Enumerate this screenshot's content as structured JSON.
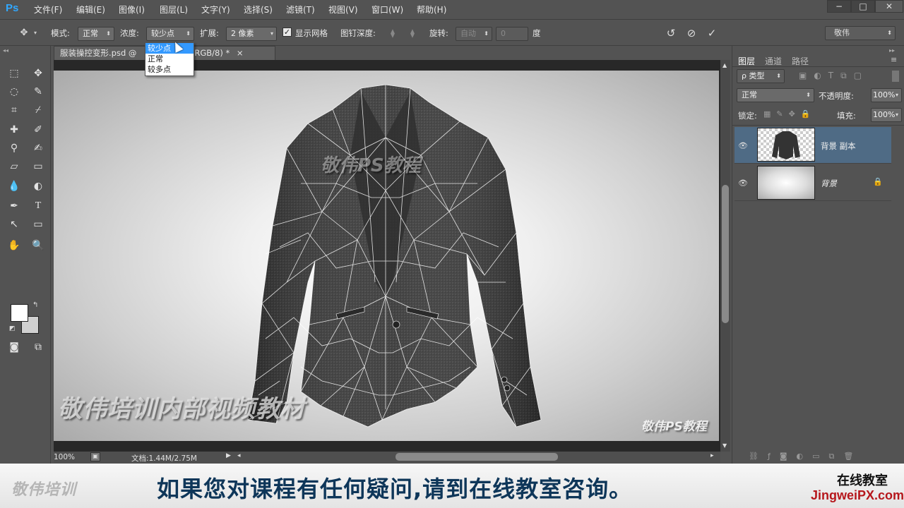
{
  "app": {
    "logo": "Ps"
  },
  "menu": [
    "文件(F)",
    "编辑(E)",
    "图像(I)",
    "图层(L)",
    "文字(Y)",
    "选择(S)",
    "滤镜(T)",
    "视图(V)",
    "窗口(W)",
    "帮助(H)"
  ],
  "window_controls": {
    "minimize": "−",
    "maximize": "□",
    "close": "✕"
  },
  "options": {
    "mode_label": "模式:",
    "mode_value": "正常",
    "density_label": "浓度:",
    "density_value": "较少点",
    "expand_label": "扩展:",
    "expand_value": "2 像素",
    "show_mesh_label": "显示网格",
    "show_mesh_checked": true,
    "pin_depth_label": "图钉深度:",
    "rotate_label": "旋转:",
    "rotate_value": "自动",
    "rotate_degrees": "0",
    "degree_unit": "度",
    "workspace": "敬伟"
  },
  "density_dropdown": {
    "items": [
      "较少点",
      "正常",
      "较多点"
    ],
    "selected": "较少点"
  },
  "document": {
    "tab_title": "服装操控变形.psd @",
    "tab_title_tail": "副本, RGB/8) *",
    "zoom": "100%",
    "doc_info": "文档:1.44M/2.75M",
    "canvas_watermark_left": "敬伟培训内部视频教材",
    "canvas_watermark_right": "敬伟PS教程",
    "jacket_logo": "敬伟PS教程"
  },
  "layers_panel": {
    "tabs": [
      "图层",
      "通道",
      "路径"
    ],
    "filter_label": "ρ 类型",
    "blend_mode": "正常",
    "opacity_label": "不透明度:",
    "opacity_value": "100%",
    "lock_label": "锁定:",
    "fill_label": "填充:",
    "fill_value": "100%",
    "layers": [
      {
        "name": "背景 副本",
        "selected": true,
        "locked": false
      },
      {
        "name": "背景",
        "selected": false,
        "locked": true
      }
    ]
  },
  "subtitle": {
    "brand_left": "敬伟培训",
    "text": "如果您对课程有任何疑问,请到在线教室咨询。",
    "brand_right_line1": "在线教室",
    "brand_right_line2": "JingweiPX.com"
  }
}
